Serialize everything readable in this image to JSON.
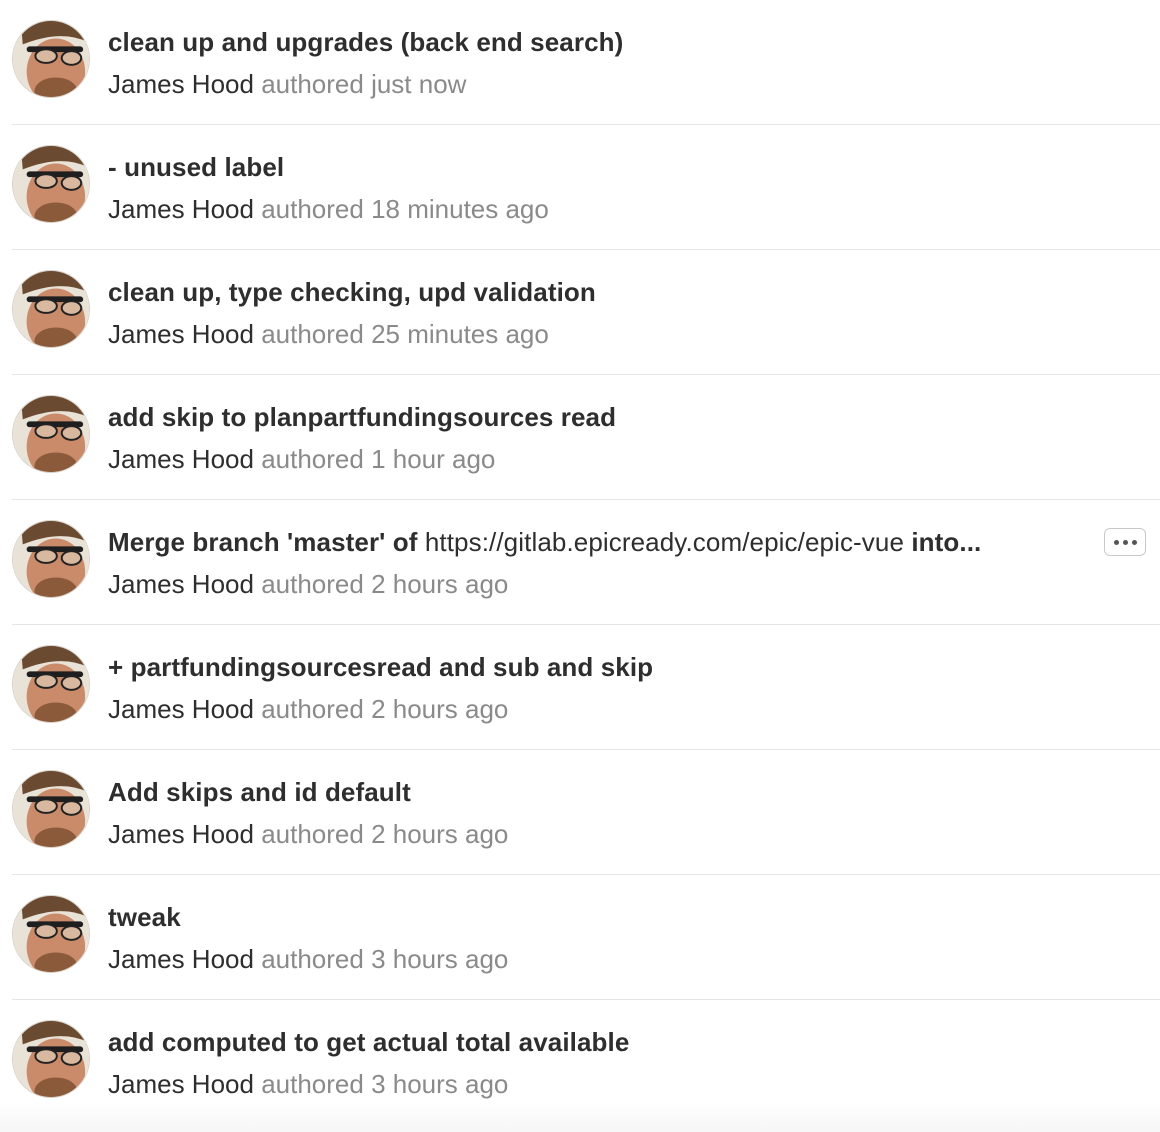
{
  "commits": [
    {
      "title": "clean up and upgrades (back end search)",
      "author": "James Hood",
      "authored": "authored just now"
    },
    {
      "title": "- unused label",
      "author": "James Hood",
      "authored": "authored 18 minutes ago"
    },
    {
      "title": "clean up, type checking, upd validation",
      "author": "James Hood",
      "authored": "authored 25 minutes ago"
    },
    {
      "title": "add skip to planpartfundingsources read",
      "author": "James Hood",
      "authored": "authored 1 hour ago"
    },
    {
      "title_prefix": "Merge branch 'master' of ",
      "title_link": "https://gitlab.epicready.com/epic/epic-vue",
      "title_suffix": " into...",
      "author": "James Hood",
      "authored": "authored 2 hours ago",
      "has_expand_button": true,
      "expand_icon": "ellipsis-icon"
    },
    {
      "title": "+ partfundingsourcesread and sub and skip",
      "author": "James Hood",
      "authored": "authored 2 hours ago"
    },
    {
      "title": "Add skips and id default",
      "author": "James Hood",
      "authored": "authored 2 hours ago"
    },
    {
      "title": "tweak",
      "author": "James Hood",
      "authored": "authored 3 hours ago"
    },
    {
      "title": "add computed to get actual total available",
      "author": "James Hood",
      "authored": "authored 3 hours ago"
    }
  ],
  "colors": {
    "title": "#2e2e2e",
    "muted": "#8a8a8a",
    "divider": "#e6e6e6"
  }
}
